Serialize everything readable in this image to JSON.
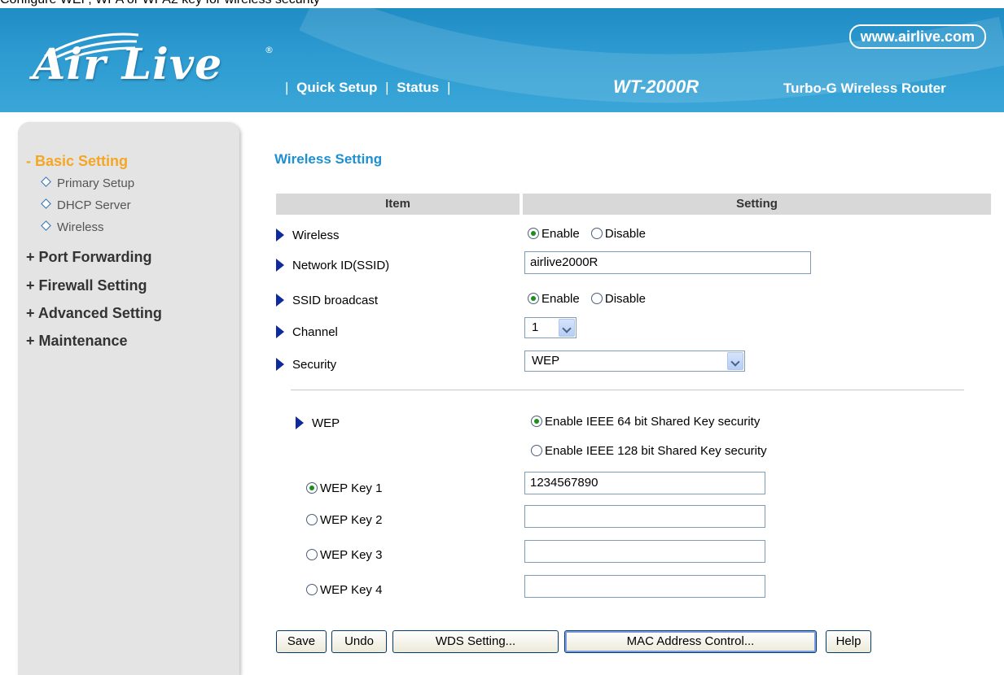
{
  "caption": "Configure WEP, WPA or WPA2 key for wireless security",
  "header": {
    "logo_text": "Air Live",
    "logo_reg": "®",
    "url": "www.airlive.com",
    "nav": [
      "Quick Setup",
      "Status"
    ],
    "nav_sep": "|",
    "model": "WT-2000R",
    "tagline": "Turbo-G Wireless Router"
  },
  "sidebar": {
    "basic": "- Basic Setting",
    "subitems": [
      "Primary Setup",
      "DHCP Server",
      "Wireless"
    ],
    "port_forwarding": "+ Port Forwarding",
    "firewall": "+ Firewall Setting",
    "advanced": "+ Advanced Setting",
    "maintenance": "+ Maintenance"
  },
  "main": {
    "title": "Wireless Setting",
    "col_item": "Item",
    "col_setting": "Setting",
    "rows": {
      "wireless": {
        "label": "Wireless",
        "opt1": "Enable",
        "opt2": "Disable",
        "selected": "Enable"
      },
      "ssid": {
        "label": "Network ID(SSID)",
        "value": "airlive2000R"
      },
      "broadcast": {
        "label": "SSID broadcast",
        "opt1": "Enable",
        "opt2": "Disable",
        "selected": "Enable"
      },
      "channel": {
        "label": "Channel",
        "value": "1"
      },
      "security": {
        "label": "Security",
        "value": "WEP"
      }
    },
    "wep": {
      "label": "WEP",
      "opt64": "Enable IEEE 64 bit Shared Key security",
      "opt128": "Enable IEEE 128 bit Shared Key security",
      "selected": "64",
      "keys": [
        {
          "label": "WEP Key 1",
          "value": "1234567890",
          "selected": true
        },
        {
          "label": "WEP Key 2",
          "value": "",
          "selected": false
        },
        {
          "label": "WEP Key 3",
          "value": "",
          "selected": false
        },
        {
          "label": "WEP Key 4",
          "value": "",
          "selected": false
        }
      ]
    },
    "buttons": {
      "save": "Save",
      "undo": "Undo",
      "wds": "WDS Setting...",
      "mac": "MAC Address Control...",
      "help": "Help"
    }
  },
  "colors": {
    "header_blue": "#2c9ad0",
    "accent_orange": "#f5a623",
    "title_blue": "#1e8fd0",
    "sidebar_gray": "#e4e4e4"
  }
}
